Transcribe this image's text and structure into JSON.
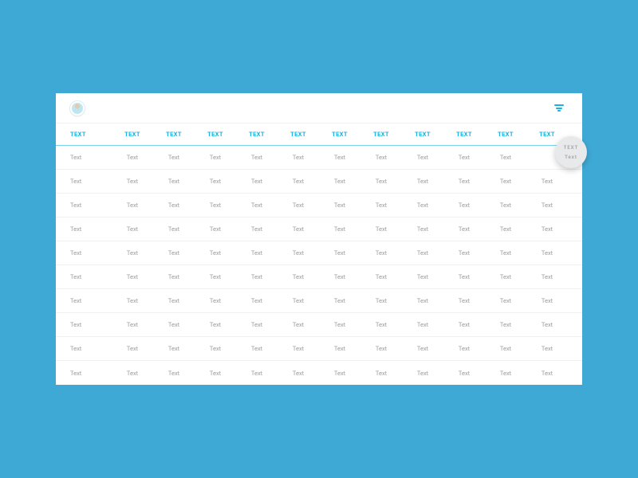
{
  "colors": {
    "accent": "#16b4e2",
    "bg": "#3fa9d6",
    "muted": "#9c9c9c"
  },
  "fab": {
    "line1": "TEXT",
    "line2": "Text"
  },
  "table": {
    "headers": [
      "TEXT",
      "TEXT",
      "TEXT",
      "TEXT",
      "TEXT",
      "TEXT",
      "TEXT",
      "TEXT",
      "TEXT",
      "TEXT",
      "TEXT",
      "TEXT"
    ],
    "rows": [
      [
        "Text",
        "Text",
        "Text",
        "Text",
        "Text",
        "Text",
        "Text",
        "Text",
        "Text",
        "Text",
        "Text",
        ""
      ],
      [
        "Text",
        "Text",
        "Text",
        "Text",
        "Text",
        "Text",
        "Text",
        "Text",
        "Text",
        "Text",
        "Text",
        "Text"
      ],
      [
        "Text",
        "Text",
        "Text",
        "Text",
        "Text",
        "Text",
        "Text",
        "Text",
        "Text",
        "Text",
        "Text",
        "Text"
      ],
      [
        "Text",
        "Text",
        "Text",
        "Text",
        "Text",
        "Text",
        "Text",
        "Text",
        "Text",
        "Text",
        "Text",
        "Text"
      ],
      [
        "Text",
        "Text",
        "Text",
        "Text",
        "Text",
        "Text",
        "Text",
        "Text",
        "Text",
        "Text",
        "Text",
        "Text"
      ],
      [
        "Text",
        "Text",
        "Text",
        "Text",
        "Text",
        "Text",
        "Text",
        "Text",
        "Text",
        "Text",
        "Text",
        "Text"
      ],
      [
        "Text",
        "Text",
        "Text",
        "Text",
        "Text",
        "Text",
        "Text",
        "Text",
        "Text",
        "Text",
        "Text",
        "Text"
      ],
      [
        "Text",
        "Text",
        "Text",
        "Text",
        "Text",
        "Text",
        "Text",
        "Text",
        "Text",
        "Text",
        "Text",
        "Text"
      ],
      [
        "Text",
        "Text",
        "Text",
        "Text",
        "Text",
        "Text",
        "Text",
        "Text",
        "Text",
        "Text",
        "Text",
        "Text"
      ],
      [
        "Text",
        "Text",
        "Text",
        "Text",
        "Text",
        "Text",
        "Text",
        "Text",
        "Text",
        "Text",
        "Text",
        "Text"
      ]
    ]
  }
}
